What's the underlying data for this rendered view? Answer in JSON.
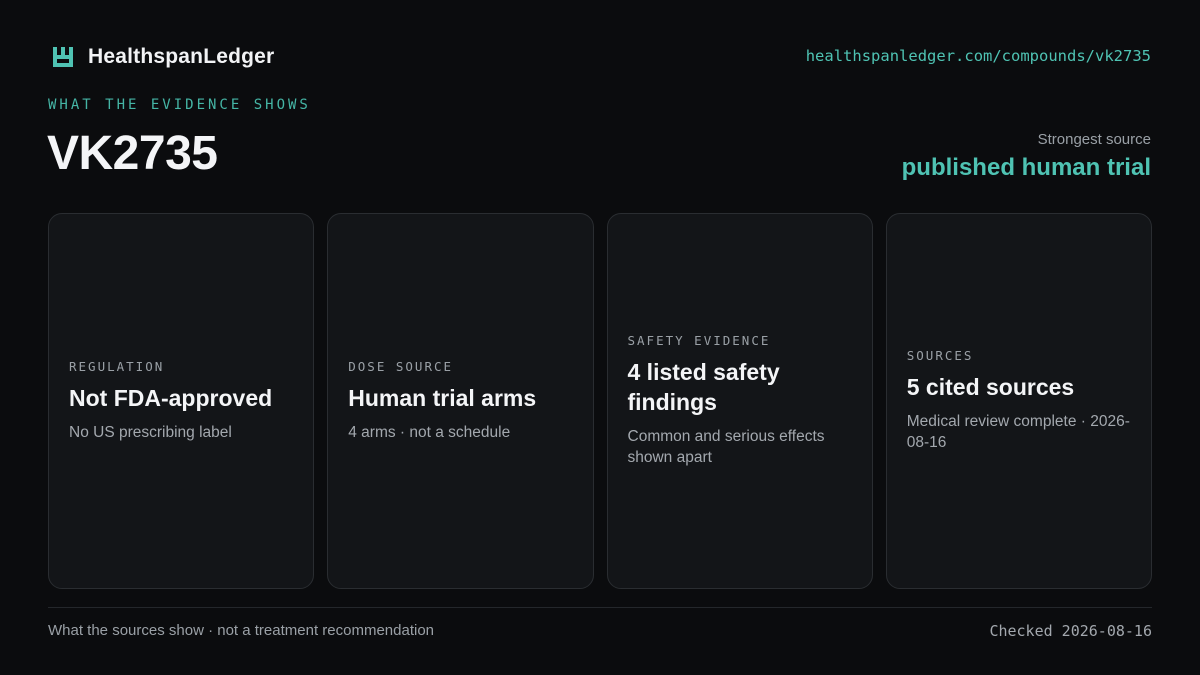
{
  "brand": {
    "name": "HealthspanLedger",
    "logo_icon": "ledger-logo-icon",
    "accent_color": "#4fc3b3"
  },
  "header": {
    "url": "healthspanledger.com/compounds/vk2735",
    "eyebrow": "WHAT THE EVIDENCE SHOWS",
    "title": "VK2735",
    "strongest_source_label": "Strongest source",
    "strongest_source_value": "published human trial"
  },
  "cards": [
    {
      "eyebrow": "REGULATION",
      "value": "Not FDA-approved",
      "note": "No US prescribing label"
    },
    {
      "eyebrow": "DOSE SOURCE",
      "value": "Human trial arms",
      "note": "4 arms · not a schedule"
    },
    {
      "eyebrow": "SAFETY EVIDENCE",
      "value": "4 listed safety findings",
      "note": "Common and serious effects shown apart"
    },
    {
      "eyebrow": "SOURCES",
      "value": "5 cited sources",
      "note": "Medical review complete · 2026-08-16"
    }
  ],
  "footer": {
    "disclaimer": "What the sources show · not a treatment recommendation",
    "checked": "Checked 2026-08-16"
  }
}
